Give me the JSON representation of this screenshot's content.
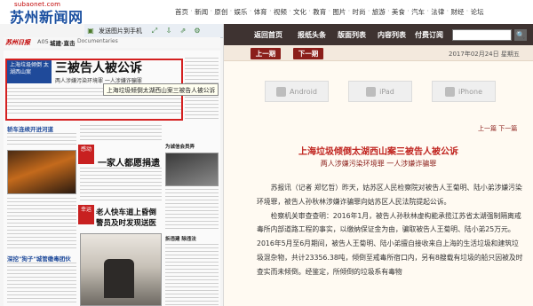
{
  "site": {
    "logo_small": "subaonet.com",
    "logo_main": "苏州新闻网"
  },
  "top_nav": [
    "首页",
    "新闻",
    "原创",
    "娱乐",
    "体育",
    "视频",
    "文化",
    "教育",
    "图片",
    "时尚",
    "旅游",
    "美食",
    "汽车",
    "法律",
    "财经",
    "论坛"
  ],
  "paper": {
    "masthead_brand": "苏州日报",
    "masthead_issue": "A05",
    "masthead_section": "城建·直击",
    "masthead_docs": "Documentaries",
    "send_to_phone": "发送图片到手机",
    "lead_banner": "上海垃圾倾倒 太湖西山案",
    "lead_title": "三被告人被公诉",
    "lead_subtitle": "两人涉嫌污染环境罪 一人涉嫌诈骗罪",
    "tooltip": "上海垃圾倾倒太湖西山案三被告人被公诉",
    "side_title_1": "轿车连续开进河道",
    "side_title_2": "深挖\"狗子\"城管缴毒团伙",
    "story2_kicker": "感动",
    "story2_title": "一家人都愿捐遗",
    "story3_kicker": "幸运",
    "story3_title1": "老人快车道上昏倒",
    "story3_title2": "警员及时发现送医",
    "side_col_1": "为诚信会员弄",
    "side_col_2": "拆违建 除违法"
  },
  "article_nav": {
    "items": [
      "返回首页",
      "报纸头条",
      "版面列表",
      "内容列表",
      "付费订阅"
    ],
    "search_placeholder": "",
    "search_button": "🔍"
  },
  "version_bar": {
    "prev": "上一期",
    "next": "下一期",
    "date": "2017年02月24日  星期五"
  },
  "devices": [
    "Android",
    "iPad",
    "iPhone"
  ],
  "prevnext": "上一篇  下一篇",
  "article": {
    "title": "上海垃圾倾倒太湖西山案三被告人被公诉",
    "subtitle": "两人涉嫌污染环境罪 一人涉嫌诈骗罪",
    "paragraphs": [
      "苏报讯（记者 郑忆哲）昨天，姑苏区人民检察院对被告人王菊明、陆小弟涉嫌污染环境罪，被告人孙秋林涉嫌诈骗罪向姑苏区人民法院提起公诉。",
      "检察机关审查查明：2016年1月，被告人孙秋林虚构能承揽江苏省太湖强制隔离戒毒所内部道路工程的事实，以缴纳保证金为由，骗取被告人王菊明、陆小弟25万元。2016年5月至6月期间，被告人王菊明、陆小弟擅自接收来自上海的生活垃圾和建筑垃圾混杂物，共计23356.38吨，倾倒至戒毒所宿口内，另有8艘载有垃圾的船只因被及时查实而未倾倒。经鉴定，所倾倒的垃圾系有毒物"
    ]
  }
}
